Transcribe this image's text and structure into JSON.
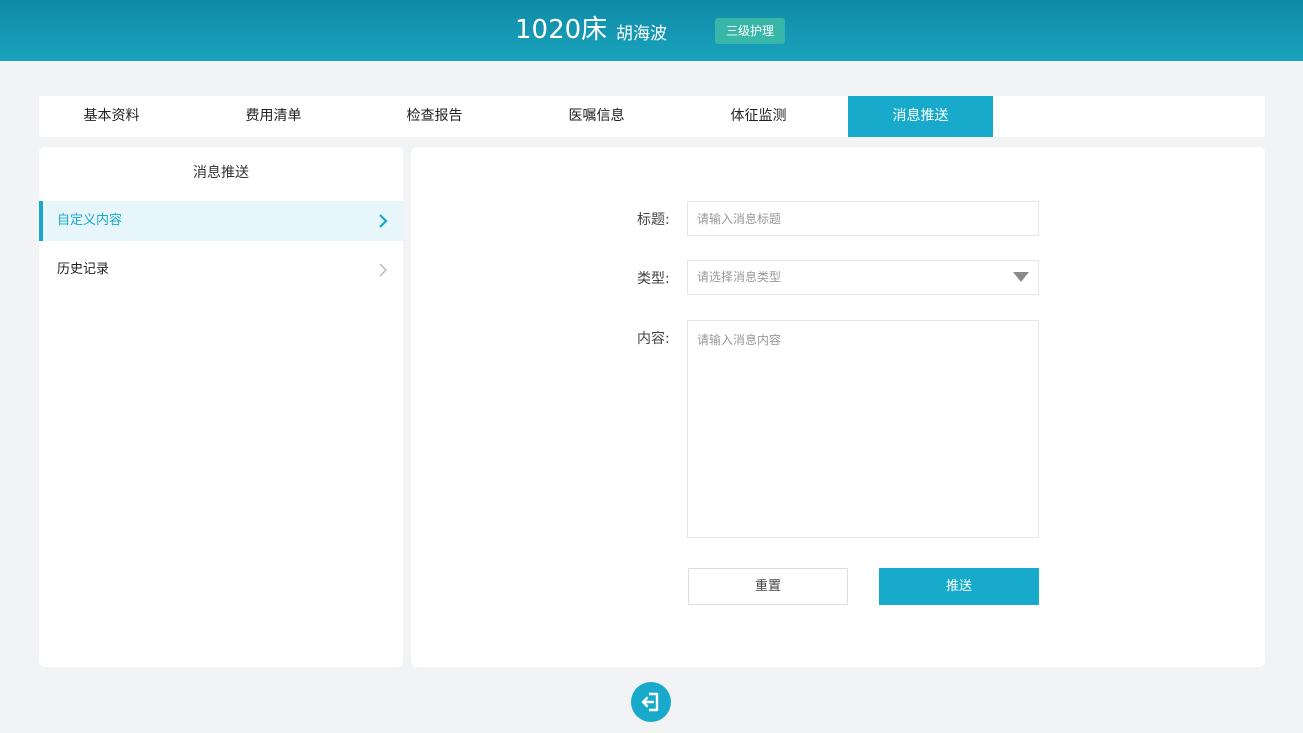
{
  "header": {
    "bed": "1020床",
    "patient_name": "胡海波",
    "care_level": "三级护理"
  },
  "tabs": [
    {
      "label": "基本资料",
      "active": false
    },
    {
      "label": "费用清单",
      "active": false
    },
    {
      "label": "检查报告",
      "active": false
    },
    {
      "label": "医嘱信息",
      "active": false
    },
    {
      "label": "体征监测",
      "active": false
    },
    {
      "label": "消息推送",
      "active": true
    }
  ],
  "sidebar": {
    "title": "消息推送",
    "items": [
      {
        "label": "自定义内容",
        "active": true,
        "icon": "chevron-right-icon"
      },
      {
        "label": "历史记录",
        "active": false,
        "icon": "chevron-right-icon"
      }
    ]
  },
  "form": {
    "title_label": "标题:",
    "title_placeholder": "请输入消息标题",
    "title_value": "",
    "type_label": "类型:",
    "type_placeholder": "请选择消息类型",
    "content_label": "内容:",
    "content_placeholder": "请输入消息内容",
    "content_value": "",
    "reset_label": "重置",
    "submit_label": "推送"
  },
  "footer": {
    "exit_icon": "exit-icon"
  },
  "colors": {
    "header_top": "#0f8aa6",
    "header_bottom": "#1aa3bd",
    "accent": "#17aacb",
    "badge": "#38b7a8",
    "sidebar_active_bg": "#e6f6fb"
  }
}
